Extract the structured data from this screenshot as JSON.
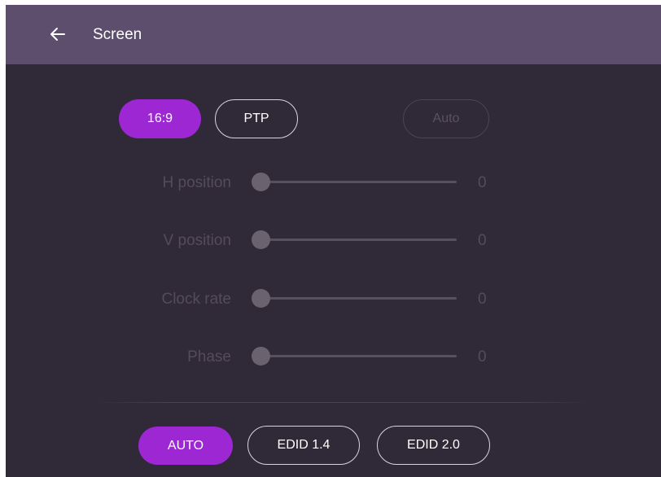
{
  "header": {
    "back_icon": "arrow-left-icon",
    "title": "Screen"
  },
  "aspect": {
    "options": [
      {
        "label": "16:9",
        "state": "selected"
      },
      {
        "label": "PTP",
        "state": "normal"
      }
    ],
    "auto_label": "Auto",
    "auto_state": "disabled"
  },
  "adjustments": [
    {
      "label": "H position",
      "value": "0"
    },
    {
      "label": "V position",
      "value": "0"
    },
    {
      "label": "Clock rate",
      "value": "0"
    },
    {
      "label": "Phase",
      "value": "0"
    }
  ],
  "edid": {
    "options": [
      {
        "label": "AUTO",
        "state": "selected"
      },
      {
        "label": "EDID 1.4",
        "state": "normal"
      },
      {
        "label": "EDID 2.0",
        "state": "normal"
      }
    ]
  },
  "colors": {
    "accent": "#9c27d3",
    "header_bg": "#5d4e6e",
    "panel_bg": "#302937"
  }
}
